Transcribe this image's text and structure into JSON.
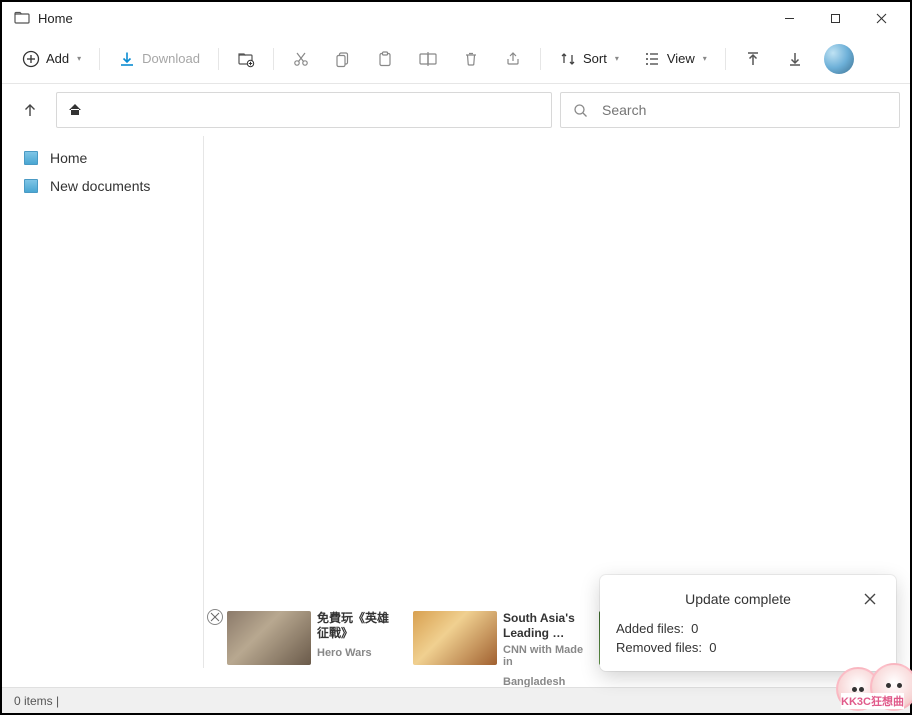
{
  "window": {
    "title": "Home"
  },
  "toolbar": {
    "add_label": "Add",
    "download_label": "Download",
    "sort_label": "Sort",
    "view_label": "View"
  },
  "search": {
    "placeholder": "Search"
  },
  "sidebar": {
    "items": [
      {
        "label": "Home"
      },
      {
        "label": "New documents"
      }
    ]
  },
  "status": {
    "items_count": 0,
    "items_text": "0 items |"
  },
  "toast": {
    "title": "Update complete",
    "added_label": "Added files:",
    "added_value": 0,
    "removed_label": "Removed files:",
    "removed_value": 0
  },
  "ads": [
    {
      "title": "免費玩《英雄征戰》",
      "sub": "Hero Wars"
    },
    {
      "title": "South Asia's Leading …",
      "sub": "CNN with Made in",
      "sub2": "Bangladesh"
    },
    {
      "title": "",
      "sub": ""
    }
  ],
  "watermark": {
    "text": "KK3C狂想曲"
  }
}
